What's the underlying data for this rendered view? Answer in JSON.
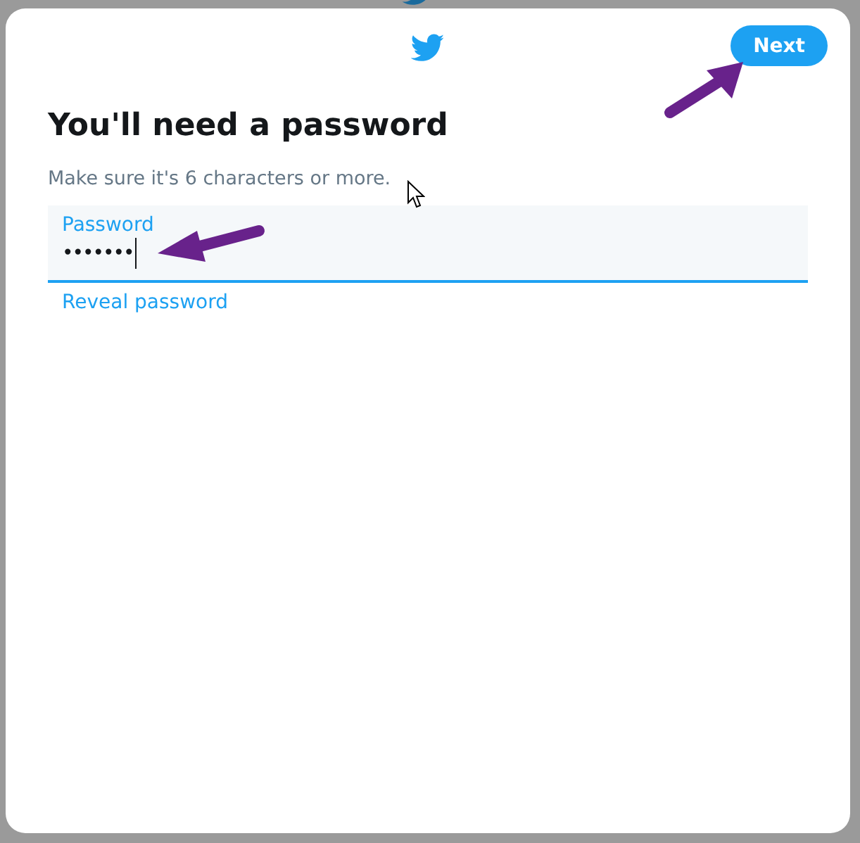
{
  "header": {
    "next_button": "Next"
  },
  "title": "You'll need a password",
  "subtitle": "Make sure it's 6 characters or more.",
  "password_field": {
    "label": "Password",
    "value": "•••••••",
    "focused": true
  },
  "reveal_link": "Reveal password"
}
